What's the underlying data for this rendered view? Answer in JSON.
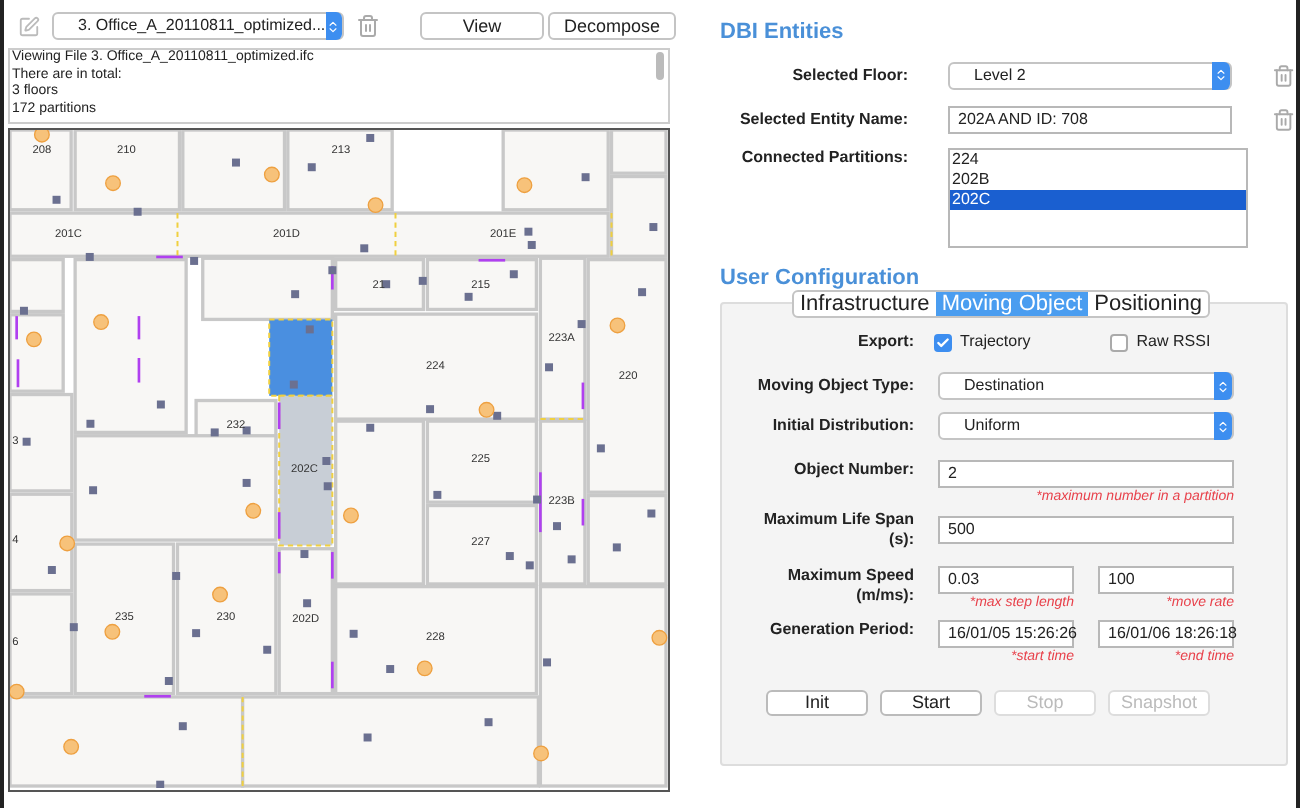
{
  "file_toolbar": {
    "file_select": "3. Office_A_20110811_optimized...",
    "buttons": [
      "View",
      "Decompose"
    ]
  },
  "info_text": [
    "Viewing File 3. Office_A_20110811_optimized.ifc",
    "There are in total:",
    "3 floors",
    "172 partitions"
  ],
  "floor_plan": {
    "room_labels": [
      "208",
      "210",
      "213",
      "201C",
      "201D",
      "201E",
      "21",
      "215",
      "223A",
      "224",
      "220",
      "232",
      "202C",
      "225",
      "223B",
      "227",
      "235",
      "230",
      "202D",
      "228",
      "3",
      "4",
      "6"
    ]
  },
  "dbi_entities": {
    "title": "DBI Entities",
    "selected_floor": {
      "label": "Selected Floor:",
      "value": "Level 2"
    },
    "selected_entity": {
      "label": "Selected Entity Name:",
      "value": "202A AND ID: 708"
    },
    "connected_partitions": {
      "label": "Connected Partitions:",
      "items": [
        {
          "text": "224",
          "selected": false
        },
        {
          "text": "202B",
          "selected": false
        },
        {
          "text": "202C",
          "selected": true
        }
      ]
    }
  },
  "user_configuration": {
    "title": "User Configuration",
    "tabs": [
      {
        "label": "Infrastructure",
        "selected": false
      },
      {
        "label": "Moving Object",
        "selected": true
      },
      {
        "label": "Positioning",
        "selected": false
      }
    ],
    "export": {
      "label": "Export:",
      "options": [
        {
          "label": "Trajectory",
          "checked": true
        },
        {
          "label": "Raw RSSI",
          "checked": false
        }
      ]
    },
    "moving_object_type": {
      "label": "Moving Object Type:",
      "value": "Destination"
    },
    "initial_distribution": {
      "label": "Initial Distribution:",
      "value": "Uniform"
    },
    "object_number": {
      "label": "Object Number:",
      "value": "2",
      "hint": "*maximum number in a partition"
    },
    "max_life_span": {
      "label": "Maximum Life Span (s):",
      "value": "500"
    },
    "max_speed": {
      "label": "Maximum Speed (m/ms):",
      "fields": [
        {
          "value": "0.03",
          "hint": "*max step length"
        },
        {
          "value": "100",
          "hint": "*move rate"
        }
      ]
    },
    "generation_period": {
      "label": "Generation Period:",
      "fields": [
        {
          "value": "16/01/05 15:26:26",
          "hint": "*start time"
        },
        {
          "value": "16/01/06 18:26:18",
          "hint": "*end time"
        }
      ]
    },
    "actions": [
      {
        "label": "Init",
        "disabled": false
      },
      {
        "label": "Start",
        "disabled": false
      },
      {
        "label": "Stop",
        "disabled": true
      },
      {
        "label": "Snapshot",
        "disabled": true
      }
    ]
  }
}
